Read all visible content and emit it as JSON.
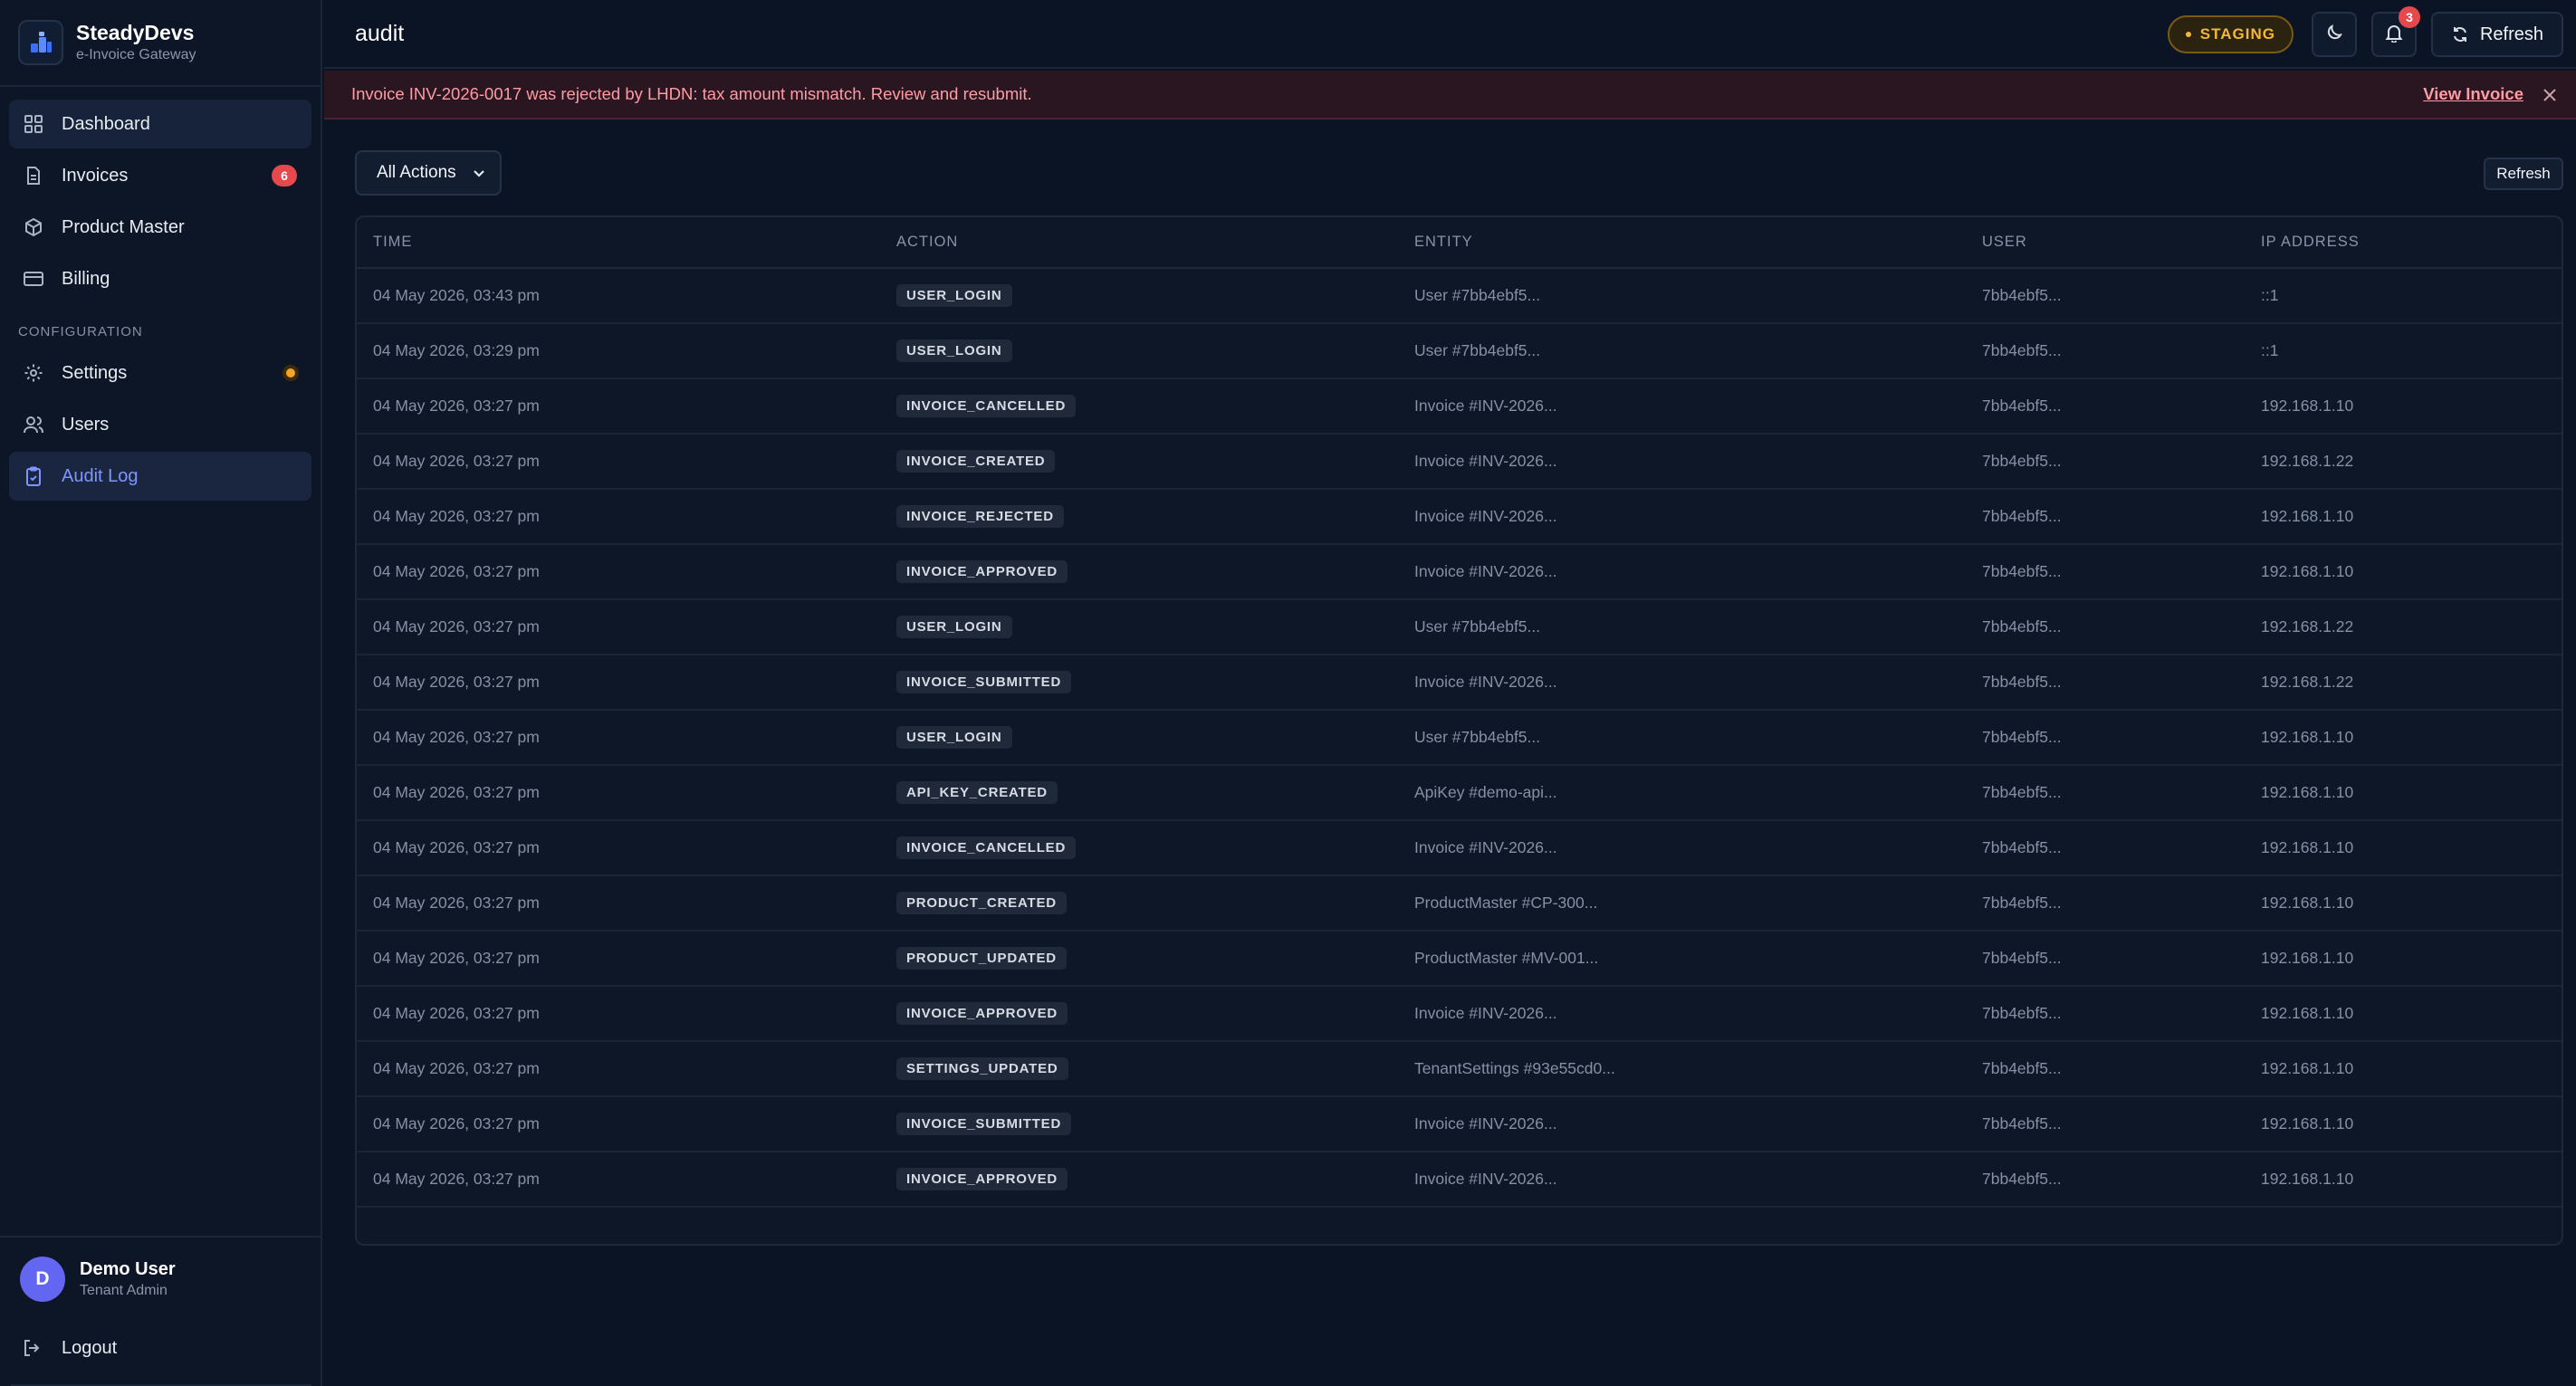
{
  "brand": {
    "name": "SteadyDevs",
    "subtitle": "e-Invoice Gateway"
  },
  "sidebar": {
    "items": [
      {
        "label": "Dashboard",
        "icon": "grid-icon"
      },
      {
        "label": "Invoices",
        "icon": "file-icon",
        "badge": "6"
      },
      {
        "label": "Product Master",
        "icon": "box-icon"
      },
      {
        "label": "Billing",
        "icon": "credit-card-icon"
      }
    ],
    "section_label": "CONFIGURATION",
    "config_items": [
      {
        "label": "Settings",
        "icon": "gear-icon"
      },
      {
        "label": "Users",
        "icon": "users-icon"
      },
      {
        "label": "Audit Log",
        "icon": "clipboard-icon"
      }
    ],
    "user": {
      "initial": "D",
      "name": "Demo User",
      "role": "Tenant Admin"
    },
    "logout_label": "Logout"
  },
  "header": {
    "title": "audit",
    "env_badge": "STAGING",
    "notification_count": "3",
    "refresh_label": "Refresh"
  },
  "alert": {
    "message": "Invoice INV-2026-0017 was rejected by LHDN: tax amount mismatch. Review and resubmit.",
    "link_label": "View Invoice"
  },
  "filters": {
    "action_select": "All Actions",
    "refresh_label": "Refresh"
  },
  "table": {
    "columns": [
      "TIME",
      "ACTION",
      "ENTITY",
      "USER",
      "IP ADDRESS"
    ],
    "rows": [
      [
        "04 May 2026, 03:43 pm",
        "USER_LOGIN",
        "User #7bb4ebf5...",
        "7bb4ebf5...",
        "::1"
      ],
      [
        "04 May 2026, 03:29 pm",
        "USER_LOGIN",
        "User #7bb4ebf5...",
        "7bb4ebf5...",
        "::1"
      ],
      [
        "04 May 2026, 03:27 pm",
        "INVOICE_CANCELLED",
        "Invoice #INV-2026...",
        "7bb4ebf5...",
        "192.168.1.10"
      ],
      [
        "04 May 2026, 03:27 pm",
        "INVOICE_CREATED",
        "Invoice #INV-2026...",
        "7bb4ebf5...",
        "192.168.1.22"
      ],
      [
        "04 May 2026, 03:27 pm",
        "INVOICE_REJECTED",
        "Invoice #INV-2026...",
        "7bb4ebf5...",
        "192.168.1.10"
      ],
      [
        "04 May 2026, 03:27 pm",
        "INVOICE_APPROVED",
        "Invoice #INV-2026...",
        "7bb4ebf5...",
        "192.168.1.10"
      ],
      [
        "04 May 2026, 03:27 pm",
        "USER_LOGIN",
        "User #7bb4ebf5...",
        "7bb4ebf5...",
        "192.168.1.22"
      ],
      [
        "04 May 2026, 03:27 pm",
        "INVOICE_SUBMITTED",
        "Invoice #INV-2026...",
        "7bb4ebf5...",
        "192.168.1.22"
      ],
      [
        "04 May 2026, 03:27 pm",
        "USER_LOGIN",
        "User #7bb4ebf5...",
        "7bb4ebf5...",
        "192.168.1.10"
      ],
      [
        "04 May 2026, 03:27 pm",
        "API_KEY_CREATED",
        "ApiKey #demo-api...",
        "7bb4ebf5...",
        "192.168.1.10"
      ],
      [
        "04 May 2026, 03:27 pm",
        "INVOICE_CANCELLED",
        "Invoice #INV-2026...",
        "7bb4ebf5...",
        "192.168.1.10"
      ],
      [
        "04 May 2026, 03:27 pm",
        "PRODUCT_CREATED",
        "ProductMaster #CP-300...",
        "7bb4ebf5...",
        "192.168.1.10"
      ],
      [
        "04 May 2026, 03:27 pm",
        "PRODUCT_UPDATED",
        "ProductMaster #MV-001...",
        "7bb4ebf5...",
        "192.168.1.10"
      ],
      [
        "04 May 2026, 03:27 pm",
        "INVOICE_APPROVED",
        "Invoice #INV-2026...",
        "7bb4ebf5...",
        "192.168.1.10"
      ],
      [
        "04 May 2026, 03:27 pm",
        "SETTINGS_UPDATED",
        "TenantSettings #93e55cd0...",
        "7bb4ebf5...",
        "192.168.1.10"
      ],
      [
        "04 May 2026, 03:27 pm",
        "INVOICE_SUBMITTED",
        "Invoice #INV-2026...",
        "7bb4ebf5...",
        "192.168.1.10"
      ],
      [
        "04 May 2026, 03:27 pm",
        "INVOICE_APPROVED",
        "Invoice #INV-2026...",
        "7bb4ebf5...",
        "192.168.1.10"
      ]
    ]
  },
  "colors": {
    "accent": "#7f95ff",
    "danger": "#e5484d",
    "warning": "#f5b834",
    "background": "#0b1424"
  }
}
